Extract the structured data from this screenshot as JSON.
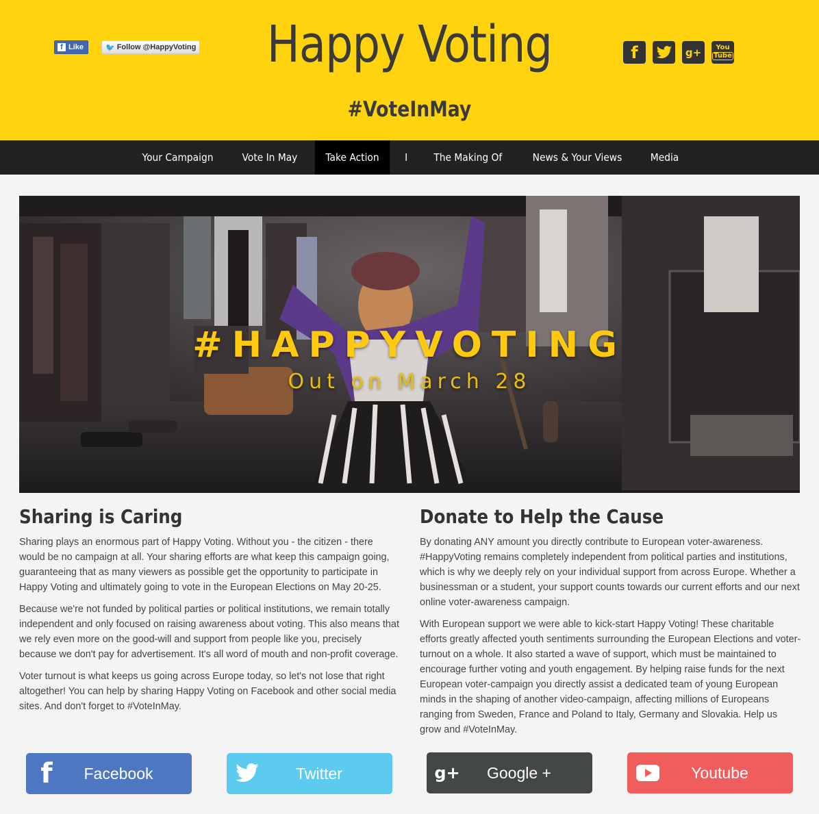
{
  "header": {
    "title": "Happy Voting",
    "hashtag": "#VoteInMay",
    "fb_like": "Like",
    "tw_follow": "Follow @HappyVoting",
    "icons": [
      "facebook-icon",
      "twitter-icon",
      "google-plus-icon",
      "youtube-icon"
    ],
    "youtube_you": "You",
    "youtube_tube": "Tube",
    "bg_color": "#ffd40f"
  },
  "nav": {
    "items": [
      {
        "label": "Your Campaign"
      },
      {
        "label": "Vote In May"
      },
      {
        "label": "Take Action",
        "active": true
      },
      {
        "label": "I"
      },
      {
        "label": "The Making Of"
      },
      {
        "label": "News & Your Views"
      },
      {
        "label": "Media"
      }
    ]
  },
  "hero": {
    "headline": "#HAPPYVOTING",
    "subline": "Out on March 28"
  },
  "sharing": {
    "title": "Sharing is Caring",
    "paragraphs": [
      "Sharing plays an enormous part of Happy Voting. Without you - the citizen - there would be no campaign at all. Your sharing efforts are what keep this campaign going, guaranteeing that as many viewers as possible get the opportunity to participate in Happy Voting and ultimately going to vote in the European Elections on May 20-25.",
      "Because we're not funded by political parties or political institutions, we remain totally independent and only focused on raising awareness about voting. This also means that we rely even more on the good-will and support from people like you, precisely because we don't pay for advertisement. It's all word of mouth and non-profit coverage.",
      "Voter turnout is what keeps us going across Europe today, so let's not lose that right altogether! You can help by sharing Happy Voting on Facebook and other social media sites. And don't forget to #VoteInMay."
    ]
  },
  "donate": {
    "title": "Donate to Help the Cause",
    "paragraphs": [
      "By donating ANY amount you directly contribute to European voter-awareness. #HappyVoting remains completely independent from political parties and institutions, which is why we deeply rely on your individual support from across Europe. Whether a businessman or a student, your support counts towards our current efforts and our next online voter-awareness campaign.",
      "With European support we were able to kick-start Happy Voting! These charitable efforts greatly affected youth sentiments surrounding the European Elections and voter-turnout on a whole. It also started a wave of support, which must be maintained to encourage further voting and youth engagement. By helping raise funds for the next European voter-campaign you directly assist a dedicated team of young European minds in the shaping of another video-campaign, affecting millions of Europeans ranging from Sweden, France and Poland to Italy, Germany and Slovakia. Help us grow and #VoteInMay."
    ]
  },
  "share_buttons": {
    "facebook": "Facebook",
    "twitter": "Twitter",
    "google": "Google +",
    "youtube": "Youtube",
    "colors": {
      "facebook": "#4d78c1",
      "twitter": "#5ccbef",
      "google": "#444748",
      "youtube": "#ef5d5c"
    }
  }
}
